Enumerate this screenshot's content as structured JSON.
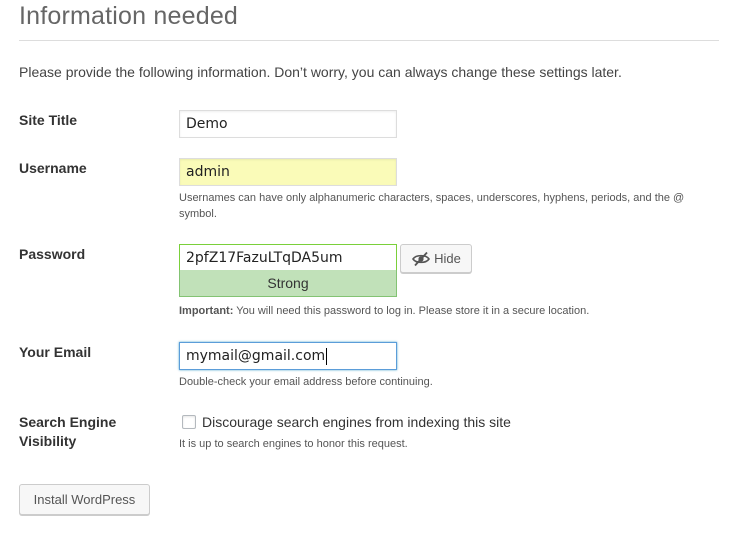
{
  "page": {
    "title": "Information needed",
    "intro": "Please provide the following information. Don’t worry, you can always change these settings later."
  },
  "form": {
    "site_title": {
      "label": "Site Title",
      "value": "Demo"
    },
    "username": {
      "label": "Username",
      "value": "admin",
      "help": "Usernames can have only alphanumeric characters, spaces, underscores, hyphens, periods, and the @ symbol."
    },
    "password": {
      "label": "Password",
      "value": "2pfZ17FazuLTqDA5um",
      "hide_label": "Hide",
      "strength": "Strong",
      "help_strong": "Important:",
      "help": " You will need this password to log in. Please store it in a secure location."
    },
    "email": {
      "label": "Your Email",
      "value": "mymail@gmail.com",
      "help": "Double-check your email address before continuing."
    },
    "search_visibility": {
      "label_line1": "Search Engine",
      "label_line2": "Visibility",
      "checkbox_label": "Discourage search engines from indexing this site",
      "checked": false,
      "help": "It is up to search engines to honor this request."
    },
    "submit_label": "Install WordPress"
  },
  "icons": {
    "hide_password": "eye-slash-icon"
  },
  "colors": {
    "strength_background": "#c1e1b9",
    "strength_border": "#83c373",
    "autofill_background": "#fafbb8",
    "focus_border": "#5b9dd9"
  }
}
